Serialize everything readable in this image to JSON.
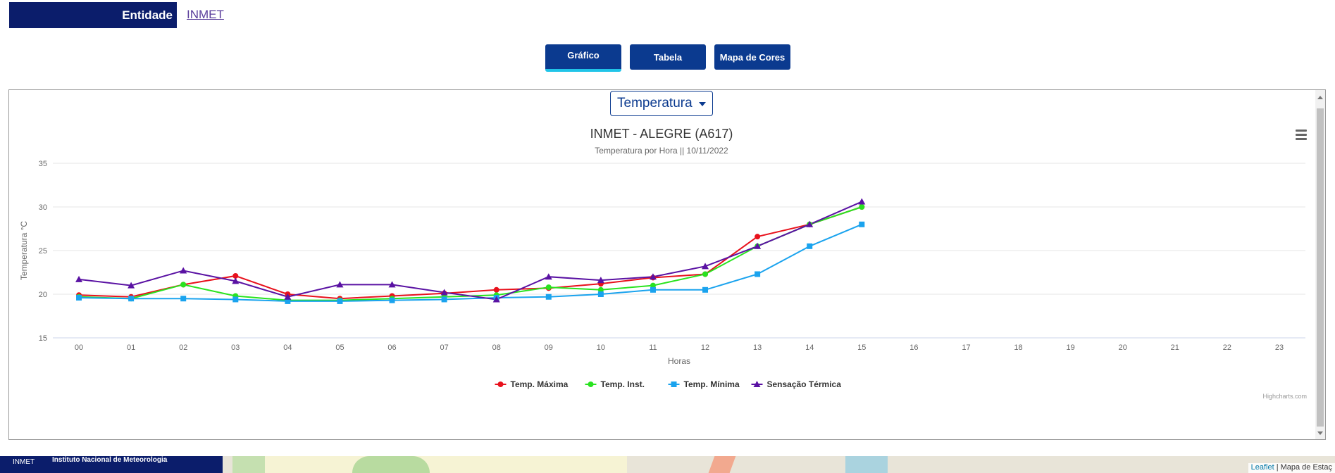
{
  "header": {
    "entity_label": "Entidade",
    "entity_value": "INMET"
  },
  "tabs": [
    {
      "label": "Gráfico",
      "active": true
    },
    {
      "label": "Tabela",
      "active": false
    },
    {
      "label": "Mapa de Cores",
      "active": false
    }
  ],
  "selector": {
    "value": "Temperatura"
  },
  "chart_data": {
    "type": "line",
    "title": "INMET - ALEGRE (A617)",
    "subtitle": "Temperatura por Hora || 10/11/2022",
    "xlabel": "Horas",
    "ylabel": "Temperatura °C",
    "categories": [
      "00",
      "01",
      "02",
      "03",
      "04",
      "05",
      "06",
      "07",
      "08",
      "09",
      "10",
      "11",
      "12",
      "13",
      "14",
      "15",
      "16",
      "17",
      "18",
      "19",
      "20",
      "21",
      "22",
      "23"
    ],
    "yticks": [
      15,
      20,
      25,
      30,
      35
    ],
    "ylim": [
      15,
      35
    ],
    "grid": true,
    "legend_position": "bottom",
    "series": [
      {
        "name": "Temp. Máxima",
        "color": "#e8111c",
        "marker": "circle",
        "values": [
          19.9,
          19.7,
          21.1,
          22.1,
          20.0,
          19.5,
          19.8,
          20.1,
          20.5,
          20.7,
          21.2,
          21.9,
          22.3,
          26.6,
          28.0,
          30.0
        ]
      },
      {
        "name": "Temp. Inst.",
        "color": "#29e31f",
        "marker": "circle",
        "values": [
          19.7,
          19.5,
          21.1,
          19.8,
          19.3,
          19.3,
          19.5,
          19.7,
          19.9,
          20.8,
          20.5,
          21.0,
          22.3,
          25.5,
          28.0,
          30.0
        ]
      },
      {
        "name": "Temp. Mínima",
        "color": "#1aa3ee",
        "marker": "square",
        "values": [
          19.6,
          19.5,
          19.5,
          19.4,
          19.2,
          19.2,
          19.3,
          19.4,
          19.6,
          19.7,
          20.0,
          20.5,
          20.5,
          22.3,
          25.5,
          28.0
        ]
      },
      {
        "name": "Sensação Térmica",
        "color": "#5a12a3",
        "marker": "triangle",
        "values": [
          21.7,
          21.0,
          22.7,
          21.5,
          19.7,
          21.1,
          21.1,
          20.2,
          19.4,
          22.0,
          21.6,
          22.0,
          23.2,
          25.5,
          28.0,
          30.6
        ]
      }
    ],
    "credits": "Highcharts.com"
  },
  "footer": {
    "brand_short": "INMET",
    "brand_full": "Instituto Nacional de Meteorologia",
    "attrib_link": "Leaflet",
    "attrib_text": " | Mapa de Estaç"
  },
  "icons": {
    "menu": "hamburger-menu-icon",
    "dropdown": "caret-down-icon"
  }
}
